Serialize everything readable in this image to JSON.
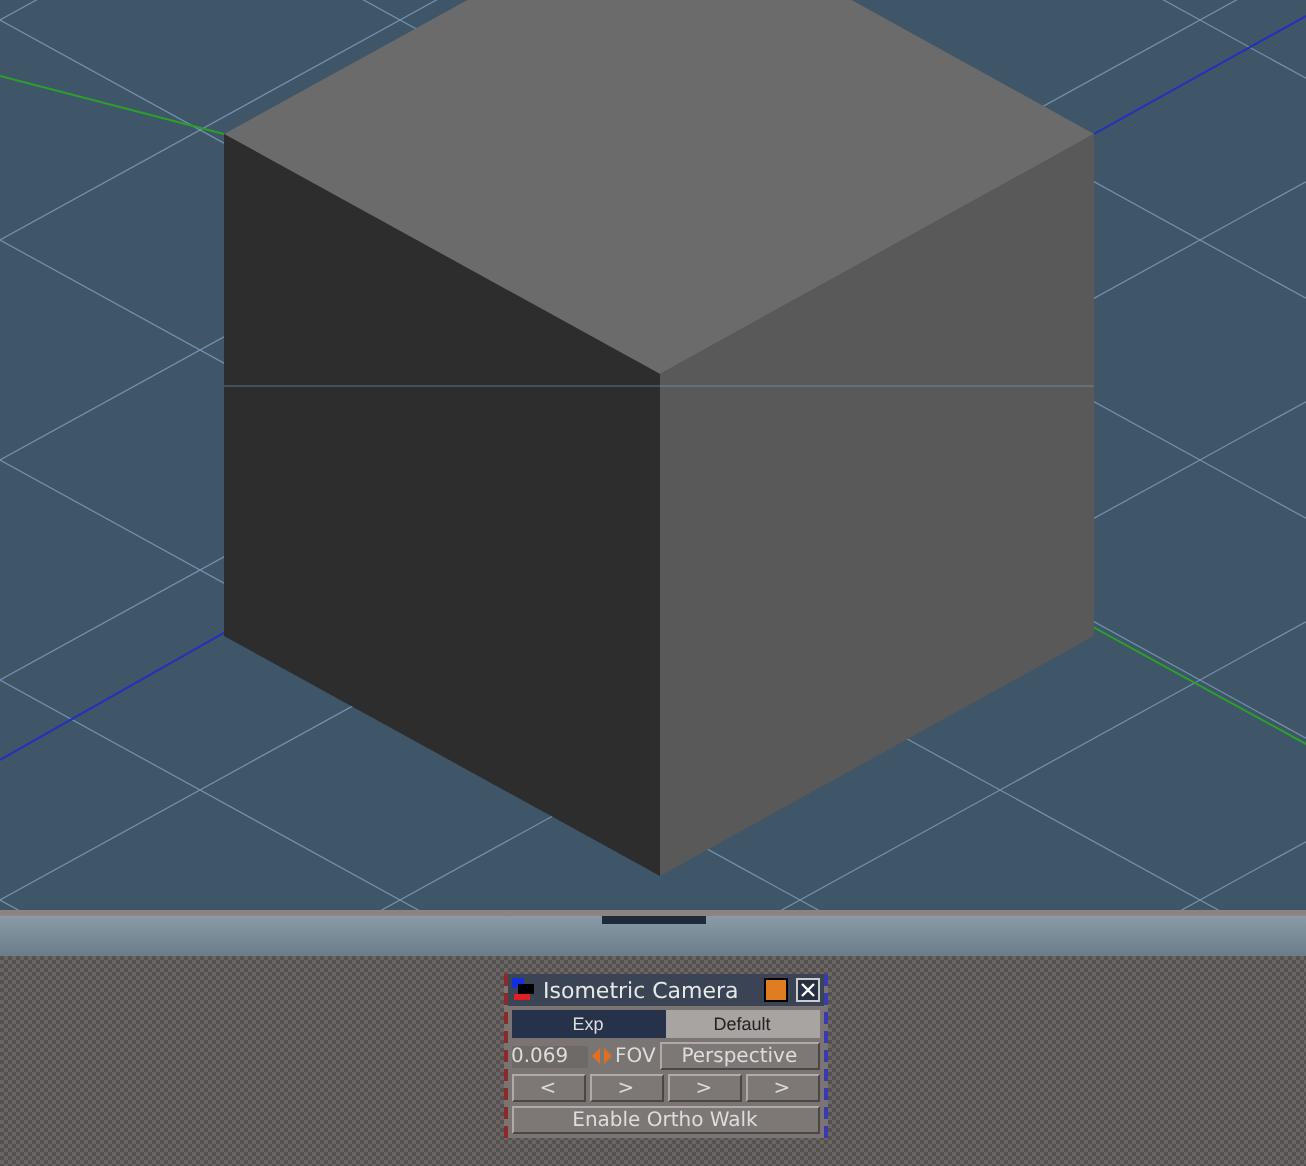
{
  "panel": {
    "title": "Isometric Camera",
    "tabs": [
      {
        "label": "Exp",
        "selected": true
      },
      {
        "label": "Default",
        "selected": false
      }
    ],
    "fov": {
      "value": "0.069",
      "label": "FOV"
    },
    "projection_button": "Perspective",
    "nav_buttons": [
      "<",
      ">",
      ">",
      ">"
    ],
    "action_button": "Enable Ortho Walk"
  }
}
